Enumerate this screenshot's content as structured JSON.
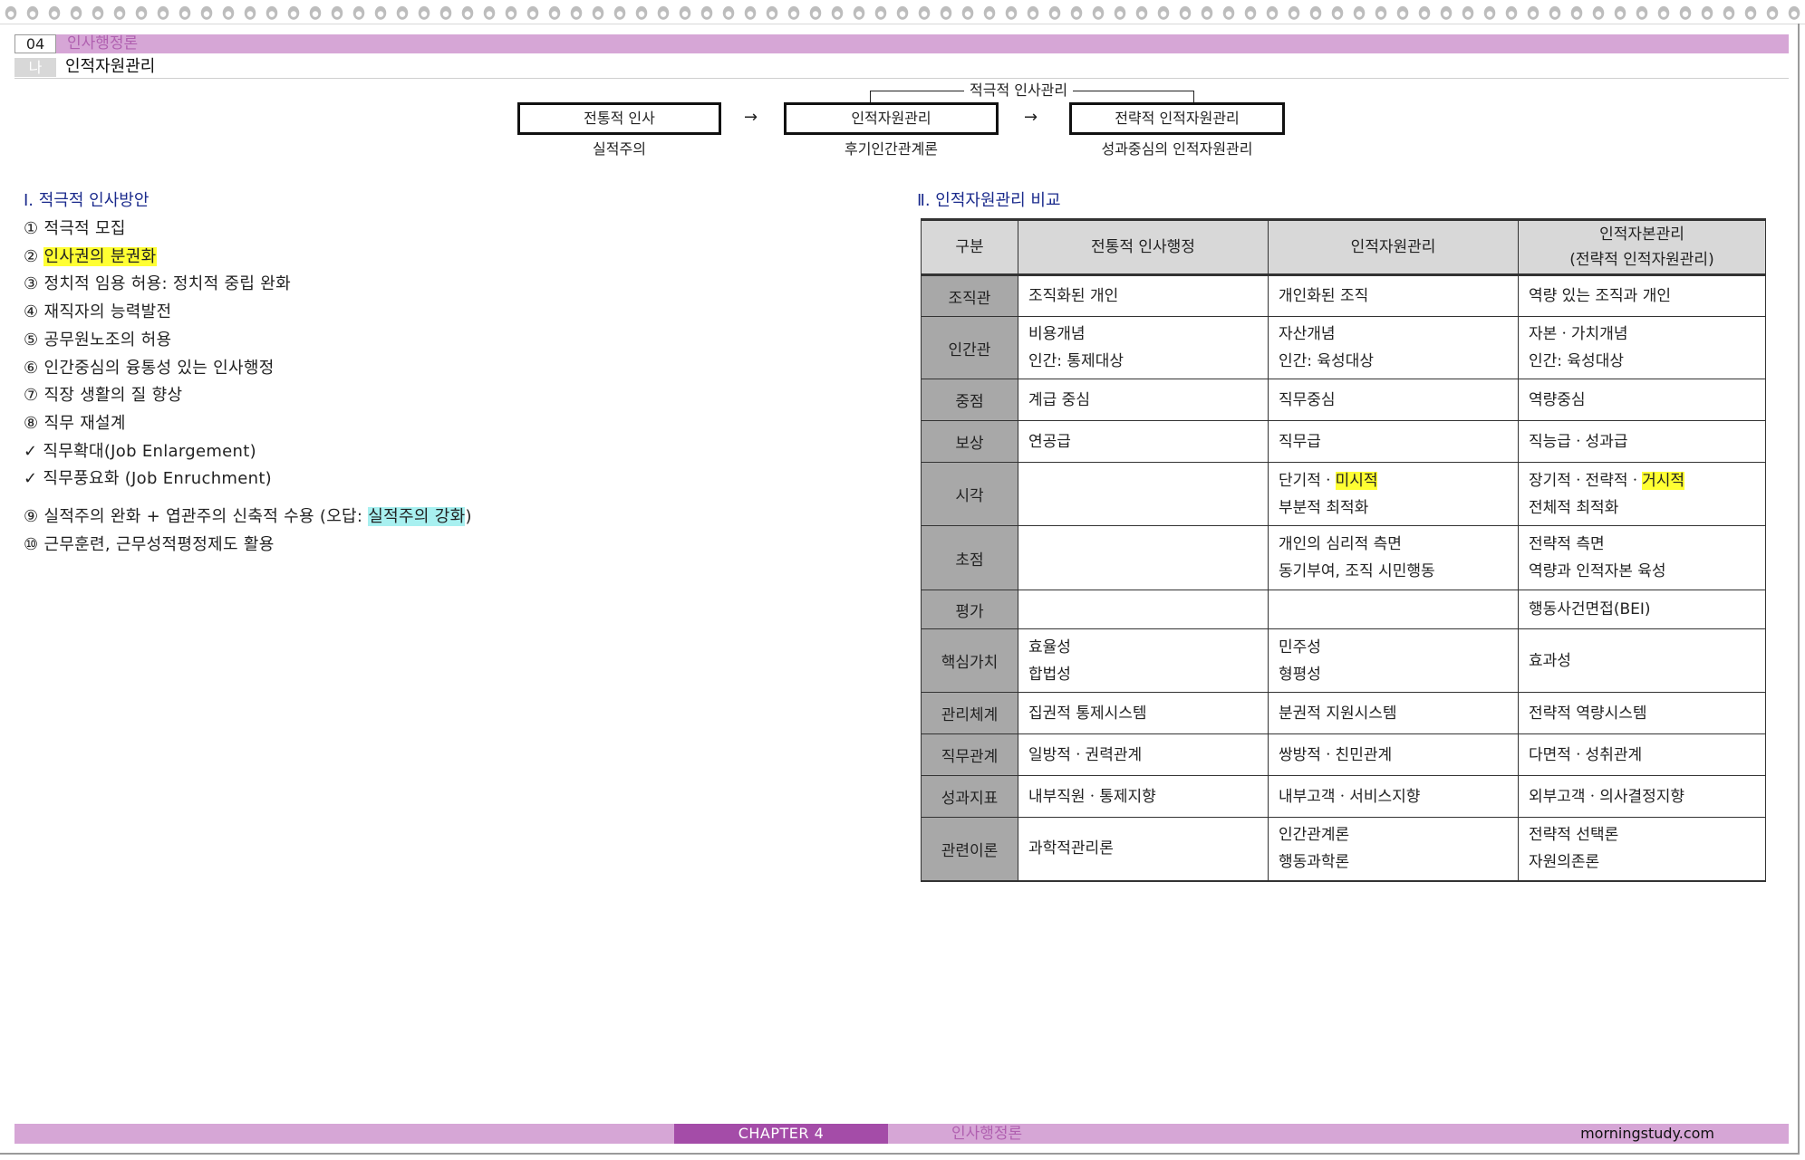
{
  "header": {
    "chapter_number": "04",
    "chapter_title": "인사행정론",
    "section_marker": "나",
    "section_title": "인적자원관리"
  },
  "flow": {
    "bracket_label": "적극적 인사관리",
    "boxes": [
      {
        "label": "전통적 인사",
        "sub": "실적주의"
      },
      {
        "label": "인적자원관리",
        "sub": "후기인간관계론"
      },
      {
        "label": "전략적 인적자원관리",
        "sub": "성과중심의 인적자원관리"
      }
    ],
    "arrow": "→"
  },
  "left": {
    "heading": "Ⅰ. 적극적 인사방안",
    "items": [
      {
        "prefix": "① 적극적 모집",
        "mark": "",
        "suffix": ""
      },
      {
        "prefix": "② ",
        "mark": "인사권의 분권화",
        "suffix": ""
      },
      {
        "prefix": "③ 정치적 임용 허용: 정치적 중립 완화",
        "mark": "",
        "suffix": ""
      },
      {
        "prefix": "④ 재직자의 능력발전",
        "mark": "",
        "suffix": ""
      },
      {
        "prefix": "⑤ 공무원노조의 허용",
        "mark": "",
        "suffix": ""
      },
      {
        "prefix": "⑥ 인간중심의 융통성 있는 인사행정",
        "mark": "",
        "suffix": ""
      },
      {
        "prefix": "⑦ 직장 생활의 질 향상",
        "mark": "",
        "suffix": ""
      },
      {
        "prefix": "⑧ 직무 재설계",
        "mark": "",
        "suffix": ""
      },
      {
        "prefix": "✓ 직무확대(Job Enlargement)",
        "mark": "",
        "suffix": ""
      },
      {
        "prefix": "✓ 직무풍요화 (Job Enruchment)",
        "mark": "",
        "suffix": ""
      },
      {
        "prefix": "⑨ 실적주의 완화 + 엽관주의 신축적 수용 (오답: ",
        "mark": "실적주의 강화",
        "suffix": ")"
      },
      {
        "prefix": "⑩ 근무훈련, 근무성적평정제도 활용",
        "mark": "",
        "suffix": ""
      }
    ]
  },
  "right": {
    "heading": "Ⅱ. 인적자원관리 비교",
    "table": {
      "headers": [
        "구분",
        "전통적 인사행정",
        "인적자원관리",
        "인적자본관리",
        "(전략적 인적자원관리)"
      ],
      "rows": [
        {
          "label": "조직관",
          "c1": [
            "조직화된 개인"
          ],
          "c2": [
            "개인화된 조직"
          ],
          "c3": [
            "역량 있는 조직과 개인"
          ]
        },
        {
          "label": "인간관",
          "c1": [
            "비용개념",
            "인간: 통제대상"
          ],
          "c2": [
            "자산개념",
            "인간: 육성대상"
          ],
          "c3": [
            "자본ㆍ가치개념",
            "인간: 육성대상"
          ]
        },
        {
          "label": "중점",
          "c1": [
            "계급 중심"
          ],
          "c2": [
            "직무중심"
          ],
          "c3": [
            "역량중심"
          ]
        },
        {
          "label": "보상",
          "c1": [
            "연공급"
          ],
          "c2": [
            "직무급"
          ],
          "c3": [
            "직능급ㆍ성과급"
          ]
        },
        {
          "label": "시각",
          "c1": [],
          "c2_a": "단기적ㆍ",
          "c2_hl": "미시적",
          "c2_b": "부분적 최적화",
          "c3_a": "장기적ㆍ전략적ㆍ",
          "c3_hl": "거시적",
          "c3_b": "전체적 최적화"
        },
        {
          "label": "초점",
          "c1": [],
          "c2": [
            "개인의 심리적 측면",
            "동기부여, 조직 시민행동"
          ],
          "c3": [
            "전략적 측면",
            "역량과 인적자본 육성"
          ]
        },
        {
          "label": "평가",
          "c1": [],
          "c2": [],
          "c3": [
            "행동사건면접(BEI)"
          ]
        },
        {
          "label": "핵심가치",
          "c1": [
            "효율성",
            "합법성"
          ],
          "c2": [
            "민주성",
            "형평성"
          ],
          "c3": [
            "효과성"
          ]
        },
        {
          "label": "관리체계",
          "c1": [
            "집권적 통제시스템"
          ],
          "c2": [
            "분권적 지원시스템"
          ],
          "c3": [
            "전략적 역량시스템"
          ]
        },
        {
          "label": "직무관계",
          "c1": [
            "일방적ㆍ권력관계"
          ],
          "c2": [
            "쌍방적ㆍ친민관계"
          ],
          "c3": [
            "다면적ㆍ성취관계"
          ]
        },
        {
          "label": "성과지표",
          "c1": [
            "내부직원ㆍ통제지향"
          ],
          "c2": [
            "내부고객ㆍ서비스지향"
          ],
          "c3": [
            "외부고객ㆍ의사결정지향"
          ]
        },
        {
          "label": "관련이론",
          "c1": [
            "과학적관리론"
          ],
          "c2": [
            "인간관계론",
            "행동과학론"
          ],
          "c3": [
            "전략적 선택론",
            "자원의존론"
          ]
        }
      ]
    }
  },
  "footer": {
    "chapter_label": "CHAPTER 4",
    "title": "인사행정론",
    "site": "morningstudy.com"
  },
  "colors": {
    "accent_bar": "#d6a6d6",
    "chapter_tab": "#a44ca8",
    "heading_blue": "#1a2a8c",
    "highlight_yellow": "#ffff33",
    "highlight_cyan": "#a8f0f0"
  }
}
